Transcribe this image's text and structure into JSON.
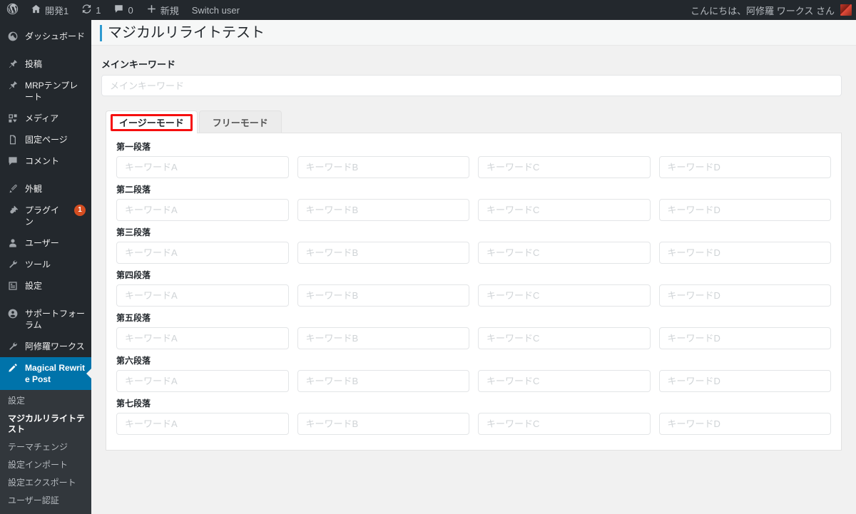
{
  "adminbar": {
    "wp_logo_icon": "wordpress-logo-icon",
    "items": [
      {
        "icon": "home-icon",
        "label": "開発1",
        "count": ""
      },
      {
        "icon": "updates-icon",
        "label": "",
        "count": "1"
      },
      {
        "icon": "comment-icon",
        "label": "",
        "count": "0"
      },
      {
        "icon": "plus-icon",
        "label": "新規",
        "count": ""
      },
      {
        "icon": "",
        "label": "Switch user",
        "count": ""
      }
    ],
    "greeting": "こんにちは、阿修羅 ワークス さん",
    "avatar_name": "avatar"
  },
  "sidebar": {
    "items": [
      {
        "label": "ダッシュボード",
        "icon": "dashboard-icon",
        "name": "dashboard",
        "active": false,
        "badge": "",
        "sep_after": true
      },
      {
        "label": "投稿",
        "icon": "pin-icon",
        "name": "posts",
        "active": false,
        "badge": "",
        "sep_after": false
      },
      {
        "label": "MRPテンプレート",
        "icon": "pin-icon",
        "name": "mrp-template",
        "active": false,
        "badge": "",
        "sep_after": false
      },
      {
        "label": "メディア",
        "icon": "media-icon",
        "name": "media",
        "active": false,
        "badge": "",
        "sep_after": false
      },
      {
        "label": "固定ページ",
        "icon": "pages-icon",
        "name": "pages",
        "active": false,
        "badge": "",
        "sep_after": false
      },
      {
        "label": "コメント",
        "icon": "comment-icon",
        "name": "comments",
        "active": false,
        "badge": "",
        "sep_after": true
      },
      {
        "label": "外観",
        "icon": "appearance-icon",
        "name": "appearance",
        "active": false,
        "badge": "",
        "sep_after": false
      },
      {
        "label": "プラグイン",
        "icon": "plugin-icon",
        "name": "plugins",
        "active": false,
        "badge": "1",
        "sep_after": false
      },
      {
        "label": "ユーザー",
        "icon": "user-icon",
        "name": "users",
        "active": false,
        "badge": "",
        "sep_after": false
      },
      {
        "label": "ツール",
        "icon": "tools-icon",
        "name": "tools",
        "active": false,
        "badge": "",
        "sep_after": false
      },
      {
        "label": "設定",
        "icon": "settings-icon",
        "name": "settings",
        "active": false,
        "badge": "",
        "sep_after": true
      },
      {
        "label": "サポートフォーラム",
        "icon": "support-icon",
        "name": "support-forum",
        "active": false,
        "badge": "",
        "sep_after": false
      },
      {
        "label": "阿修羅ワークス",
        "icon": "tools-icon",
        "name": "asuraworks",
        "active": false,
        "badge": "",
        "sep_after": false
      },
      {
        "label": "Magical Rewrite Post",
        "icon": "pencil-icon",
        "name": "magical-rewrite-post",
        "active": true,
        "badge": "",
        "sep_after": false
      }
    ],
    "submenu": [
      {
        "label": "設定",
        "current": false
      },
      {
        "label": "マジカルリライトテスト",
        "current": true
      },
      {
        "label": "テーマチェンジ",
        "current": false
      },
      {
        "label": "設定インポート",
        "current": false
      },
      {
        "label": "設定エクスポート",
        "current": false
      },
      {
        "label": "ユーザー認証",
        "current": false
      }
    ]
  },
  "page": {
    "title": "マジカルリライトテスト",
    "main_keyword_label": "メインキーワード",
    "main_keyword_placeholder": "メインキーワード",
    "main_keyword_value": ""
  },
  "tabs": [
    {
      "label": "イージーモード",
      "selected": true,
      "annotated": true
    },
    {
      "label": "フリーモード",
      "selected": false,
      "annotated": false
    }
  ],
  "paragraphs": [
    {
      "label": "第一段落",
      "placeholders": [
        "キーワードA",
        "キーワードB",
        "キーワードC",
        "キーワードD"
      ],
      "values": [
        "",
        "",
        "",
        ""
      ]
    },
    {
      "label": "第二段落",
      "placeholders": [
        "キーワードA",
        "キーワードB",
        "キーワードC",
        "キーワードD"
      ],
      "values": [
        "",
        "",
        "",
        ""
      ]
    },
    {
      "label": "第三段落",
      "placeholders": [
        "キーワードA",
        "キーワードB",
        "キーワードC",
        "キーワードD"
      ],
      "values": [
        "",
        "",
        "",
        ""
      ]
    },
    {
      "label": "第四段落",
      "placeholders": [
        "キーワードA",
        "キーワードB",
        "キーワードC",
        "キーワードD"
      ],
      "values": [
        "",
        "",
        "",
        ""
      ]
    },
    {
      "label": "第五段落",
      "placeholders": [
        "キーワードA",
        "キーワードB",
        "キーワードC",
        "キーワードD"
      ],
      "values": [
        "",
        "",
        "",
        ""
      ]
    },
    {
      "label": "第六段落",
      "placeholders": [
        "キーワードA",
        "キーワードB",
        "キーワードC",
        "キーワードD"
      ],
      "values": [
        "",
        "",
        "",
        ""
      ]
    },
    {
      "label": "第七段落",
      "placeholders": [
        "キーワードA",
        "キーワードB",
        "キーワードC",
        "キーワードD"
      ],
      "values": [
        "",
        "",
        "",
        ""
      ]
    }
  ],
  "colors": {
    "admin_dark": "#23282d",
    "submenu_dark": "#32373c",
    "accent_blue": "#0073aa",
    "title_accent": "#2e9ad0",
    "annotation_red": "#f50f0f",
    "badge_red": "#d54e21",
    "page_bg": "#f1f1f1"
  }
}
